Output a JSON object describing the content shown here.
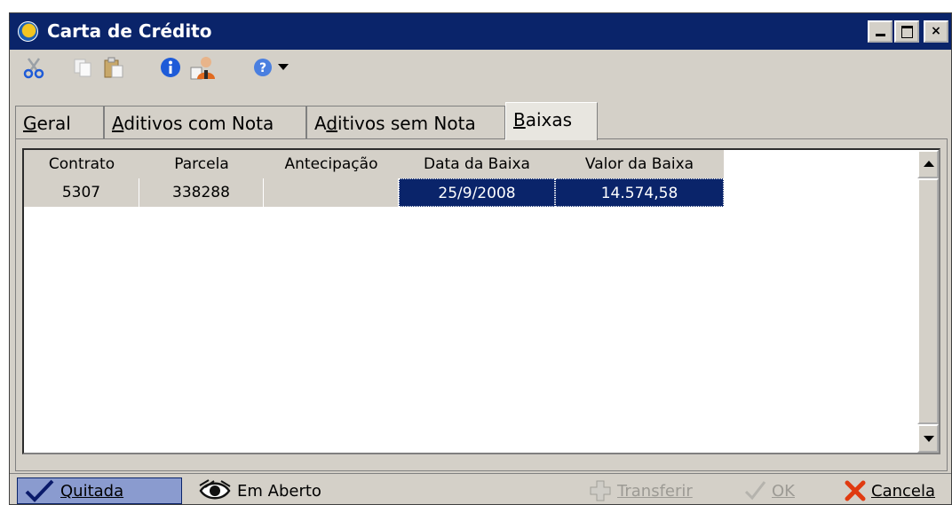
{
  "window": {
    "title": "Carta de Crédito"
  },
  "title_buttons": {
    "min": "minimize",
    "max": "maximize",
    "close": "×"
  },
  "toolbar": {
    "items": [
      {
        "icon": "cut-icon"
      },
      {
        "icon": "copy-icon"
      },
      {
        "icon": "paste-icon"
      },
      {
        "icon": "info-icon"
      },
      {
        "icon": "user-icon"
      },
      {
        "icon": "help-icon"
      },
      {
        "icon": "dropdown-arrow-icon"
      }
    ]
  },
  "tabs": [
    {
      "label": "Geral",
      "accel": "G"
    },
    {
      "label": "Aditivos com Nota",
      "accel": "A"
    },
    {
      "label": "Aditivos sem Nota",
      "accel": "d"
    },
    {
      "label": "Baixas",
      "accel": "B",
      "active": true
    }
  ],
  "grid": {
    "columns": [
      "Contrato",
      "Parcela",
      "Antecipação",
      "Data da Baixa",
      "Valor da Baixa"
    ],
    "rows": [
      {
        "contrato": "5307",
        "parcela": "338288",
        "antecipacao": "",
        "data_baixa": "25/9/2008",
        "valor_baixa": "14.574,58"
      }
    ]
  },
  "bottom": {
    "quitada": "Quitada",
    "em_aberto": "Em Aberto",
    "transferir": "Transferir",
    "ok": "OK",
    "cancela": "Cancela"
  },
  "colors": {
    "titlebar": "#0a246a",
    "selection": "#0a246a",
    "face": "#d4d0c8"
  }
}
